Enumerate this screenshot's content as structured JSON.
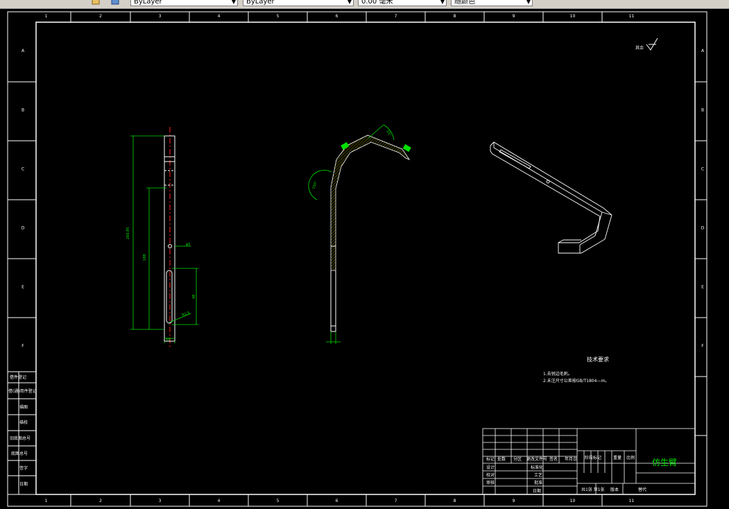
{
  "toolbar": {
    "layer_color": "ByLayer",
    "linetype": "ByLayer",
    "lineweight": "0.00 毫米",
    "plot_style": "随颜色"
  },
  "drawing": {
    "col_labels": [
      "1",
      "2",
      "3",
      "4",
      "5",
      "6",
      "7",
      "8",
      "9",
      "10",
      "11"
    ],
    "row_labels": [
      "A",
      "B",
      "C",
      "D",
      "E",
      "F"
    ],
    "roughness_label": "其余",
    "dimensions": {
      "overall_length": "260.85",
      "mid_length": "188",
      "hole_dim": "φ5",
      "slot_length": "48",
      "chamfer": "R1.5",
      "width": "10",
      "angle_top": "55°",
      "angle_left": "150°"
    },
    "tech_req_title": "技术要求",
    "tech_req_items": [
      "1.去锐边毛刺。",
      "2.未注尺寸公差按GB/T1804—m。"
    ],
    "left_block_labels": [
      "借(通)用件登记",
      "旧底图总号",
      "底图总号",
      "签字",
      "日期",
      "描图",
      "描校"
    ],
    "left_block_top": "借件登记",
    "title_block": {
      "part_name": "仿生臂",
      "row_labels": [
        "标记",
        "处数",
        "分区",
        "更改文件号",
        "签名",
        "年月日"
      ],
      "design": "设计",
      "check": "校对",
      "review": "审核",
      "standard": "标准化",
      "process": "工艺",
      "approve": "批准",
      "date_h": "日期",
      "stage": "阶段标记",
      "weight": "重量",
      "scale": "比例",
      "sheets": "共1张 第1张",
      "version": "版本",
      "replace": "替代"
    }
  }
}
